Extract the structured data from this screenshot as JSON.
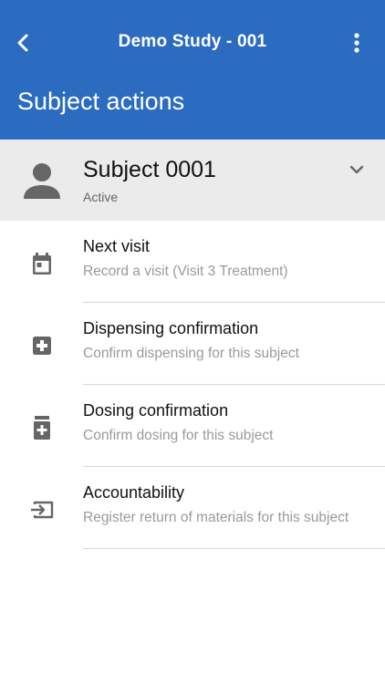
{
  "toolbar": {
    "title": "Demo Study - 001",
    "back_icon": "arrow-back-icon",
    "menu_icon": "more-vert-icon"
  },
  "page": {
    "title": "Subject actions"
  },
  "subject": {
    "name": "Subject 0001",
    "status": "Active",
    "avatar_icon": "person-icon",
    "expand_icon": "chevron-down-icon"
  },
  "actions": [
    {
      "title": "Next visit",
      "subtitle": "Record a visit (Visit 3 Treatment)",
      "icon": "calendar-icon"
    },
    {
      "title": "Dispensing confirmation",
      "subtitle": "Confirm dispensing for this subject",
      "icon": "medical-plus-icon"
    },
    {
      "title": "Dosing confirmation",
      "subtitle": "Confirm dosing for this subject",
      "icon": "medication-bottle-icon"
    },
    {
      "title": "Accountability",
      "subtitle": "Register return of materials for this subject",
      "icon": "input-return-icon"
    }
  ],
  "colors": {
    "app_bar": "#2c6cc0",
    "subject_card": "#ebebeb",
    "icon": "#666666",
    "divider": "#d6d6d6"
  }
}
